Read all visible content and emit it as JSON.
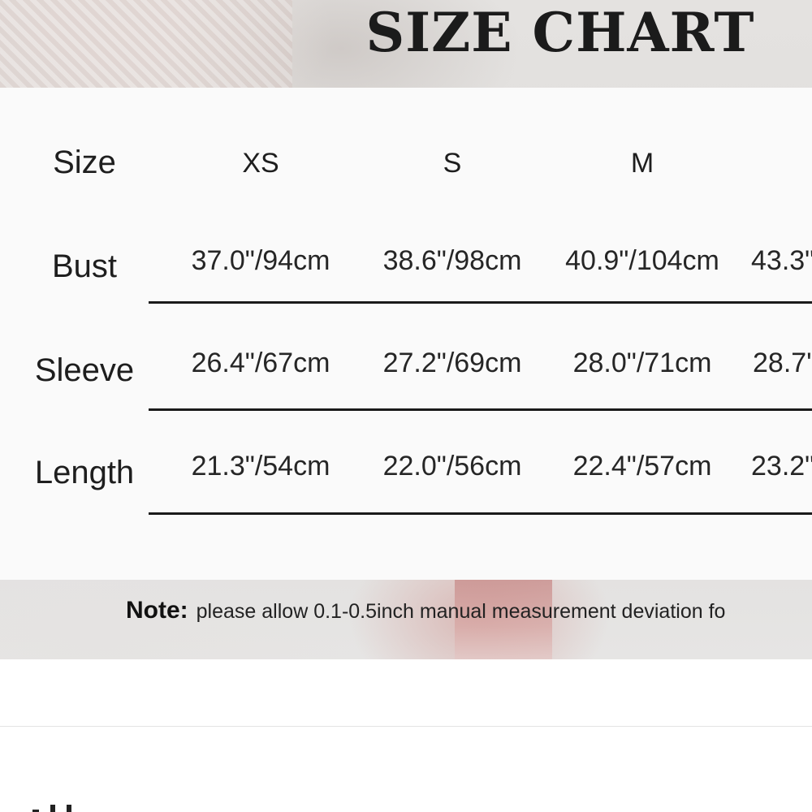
{
  "title": "SIZE CHART",
  "table": {
    "header_label": "Size",
    "sizes": [
      "XS",
      "S",
      "M"
    ],
    "rows": [
      {
        "label": "Bust",
        "values": [
          "37.0\"/94cm",
          "38.6\"/98cm",
          "40.9\"/104cm",
          "43.3\""
        ]
      },
      {
        "label": "Sleeve",
        "values": [
          "26.4\"/67cm",
          "27.2\"/69cm",
          "28.0\"/71cm",
          "28.7'"
        ]
      },
      {
        "label": "Length",
        "values": [
          "21.3\"/54cm",
          "22.0\"/56cm",
          "22.4\"/57cm",
          "23.2\""
        ]
      }
    ]
  },
  "note": {
    "label": "Note:",
    "text": "please allow 0.1-0.5inch manual measurement deviation fo"
  }
}
